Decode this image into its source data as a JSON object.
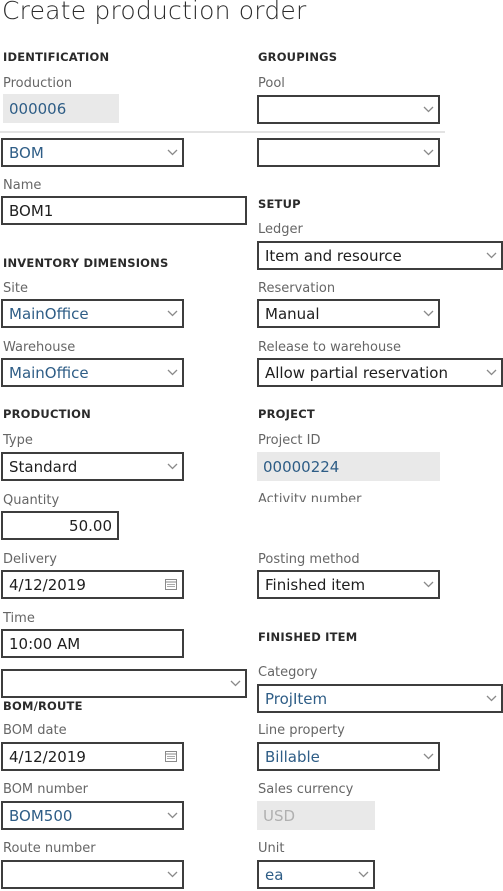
{
  "page": {
    "title": "Create production order"
  },
  "identification": {
    "heading": "IDENTIFICATION",
    "production_label": "Production",
    "production_value": "000006",
    "type_value": "BOM",
    "name_label": "Name",
    "name_value": "BOM1"
  },
  "groupings": {
    "heading": "GROUPINGS",
    "pool_label": "Pool",
    "pool_value": "",
    "second_value": ""
  },
  "setup": {
    "heading": "SETUP",
    "ledger_label": "Ledger",
    "ledger_value": "Item and resource",
    "reservation_label": "Reservation",
    "reservation_value": "Manual",
    "release_label": "Release to warehouse",
    "release_value": "Allow partial reservation"
  },
  "inventory_dimensions": {
    "heading": "INVENTORY DIMENSIONS",
    "site_label": "Site",
    "site_value": "MainOffice",
    "warehouse_label": "Warehouse",
    "warehouse_value": "MainOffice"
  },
  "production": {
    "heading": "PRODUCTION",
    "type_label": "Type",
    "type_value": "Standard",
    "quantity_label": "Quantity",
    "quantity_value": "50.00",
    "delivery_label": "Delivery",
    "delivery_value": "4/12/2019",
    "time_label": "Time",
    "time_value": "10:00 AM",
    "extra_value": ""
  },
  "project": {
    "heading": "PROJECT",
    "project_id_label": "Project ID",
    "project_id_value": "00000224",
    "activity_label": "Activity number",
    "posting_label": "Posting method",
    "posting_value": "Finished item"
  },
  "finished_item": {
    "heading": "FINISHED ITEM",
    "category_label": "Category",
    "category_value": "ProjItem",
    "line_property_label": "Line property",
    "line_property_value": "Billable",
    "sales_currency_label": "Sales currency",
    "sales_currency_value": "USD",
    "unit_label": "Unit",
    "unit_value": "ea"
  },
  "bom_route": {
    "heading": "BOM/ROUTE",
    "bom_date_label": "BOM date",
    "bom_date_value": "4/12/2019",
    "bom_number_label": "BOM number",
    "bom_number_value": "BOM500",
    "route_number_label": "Route number",
    "route_number_value": ""
  },
  "icons": {
    "dropdown": "chevron-down-icon",
    "date": "calendar-icon"
  }
}
